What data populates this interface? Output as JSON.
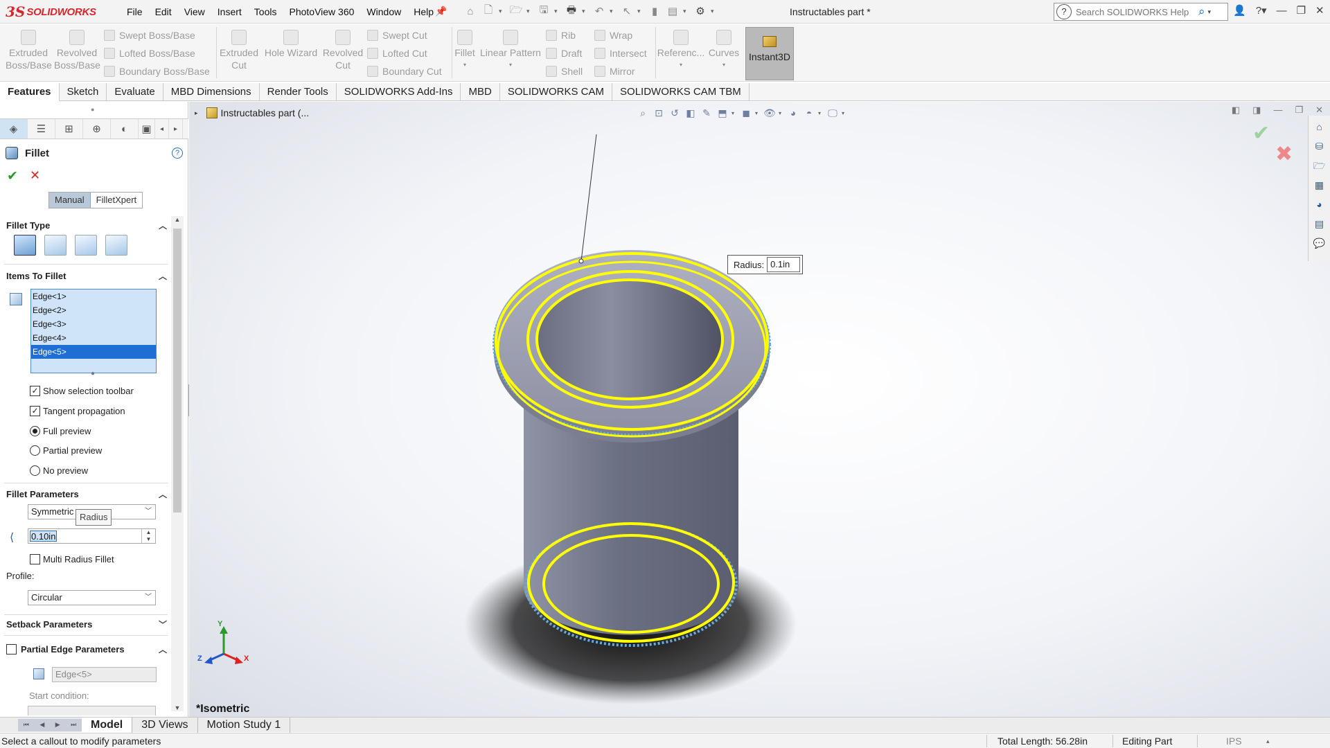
{
  "app": {
    "logo_text": "SOLIDWORKS",
    "menu": [
      "File",
      "Edit",
      "View",
      "Insert",
      "Tools",
      "PhotoView 360",
      "Window",
      "Help"
    ],
    "document_title": "Instructables part *",
    "search_placeholder": "Search SOLIDWORKS Help"
  },
  "command_manager": {
    "extruded_boss": "Extruded Boss/Base",
    "revolved_boss": "Revolved Boss/Base",
    "swept_boss": "Swept Boss/Base",
    "lofted_boss": "Lofted Boss/Base",
    "boundary_boss": "Boundary Boss/Base",
    "extruded_cut": "Extruded Cut",
    "hole_wizard": "Hole Wizard",
    "revolved_cut": "Revolved Cut",
    "swept_cut": "Swept Cut",
    "lofted_cut": "Lofted Cut",
    "boundary_cut": "Boundary Cut",
    "fillet": "Fillet",
    "linear_pattern": "Linear Pattern",
    "rib": "Rib",
    "draft": "Draft",
    "shell": "Shell",
    "wrap": "Wrap",
    "intersect": "Intersect",
    "mirror": "Mirror",
    "reference": "Referenc...",
    "curves": "Curves",
    "instant3d": "Instant3D"
  },
  "tabs": [
    "Features",
    "Sketch",
    "Evaluate",
    "MBD Dimensions",
    "Render Tools",
    "SOLIDWORKS Add-Ins",
    "MBD",
    "SOLIDWORKS CAM",
    "SOLIDWORKS CAM TBM"
  ],
  "property_manager": {
    "title": "Fillet",
    "help_glyph": "?",
    "modes": [
      "Manual",
      "FilletXpert"
    ],
    "fillet_type_heading": "Fillet Type",
    "items_heading": "Items To Fillet",
    "edges": [
      "Edge<1>",
      "Edge<2>",
      "Edge<3>",
      "Edge<4>",
      "Edge<5>"
    ],
    "show_selection_toolbar": "Show selection toolbar",
    "tangent_propagation": "Tangent propagation",
    "full_preview": "Full preview",
    "partial_preview": "Partial preview",
    "no_preview": "No preview",
    "fillet_params_heading": "Fillet Parameters",
    "symmetric": "Symmetric",
    "tooltip": "Radius",
    "radius_value": "0.10in",
    "multi_radius": "Multi Radius Fillet",
    "profile_label": "Profile:",
    "profile_value": "Circular",
    "setback_heading": "Setback Parameters",
    "partial_edge_heading": "Partial Edge Parameters",
    "partial_edge_value": "Edge<5>",
    "start_condition": "Start condition:"
  },
  "graphics": {
    "tree_label": "Instructables part  (...",
    "callout_label": "Radius:",
    "callout_value": "0.1in",
    "view_name": "*Isometric",
    "triad_x": "X",
    "triad_y": "Y",
    "triad_z": "Z",
    "edge_color": "#ffff00",
    "model_color": "#74788c"
  },
  "bottom_tabs": [
    "Model",
    "3D Views",
    "Motion Study 1"
  ],
  "status": {
    "message": "Select a callout to modify parameters",
    "total_length": "Total Length: 56.28in",
    "mode": "Editing Part",
    "units": "IPS"
  }
}
